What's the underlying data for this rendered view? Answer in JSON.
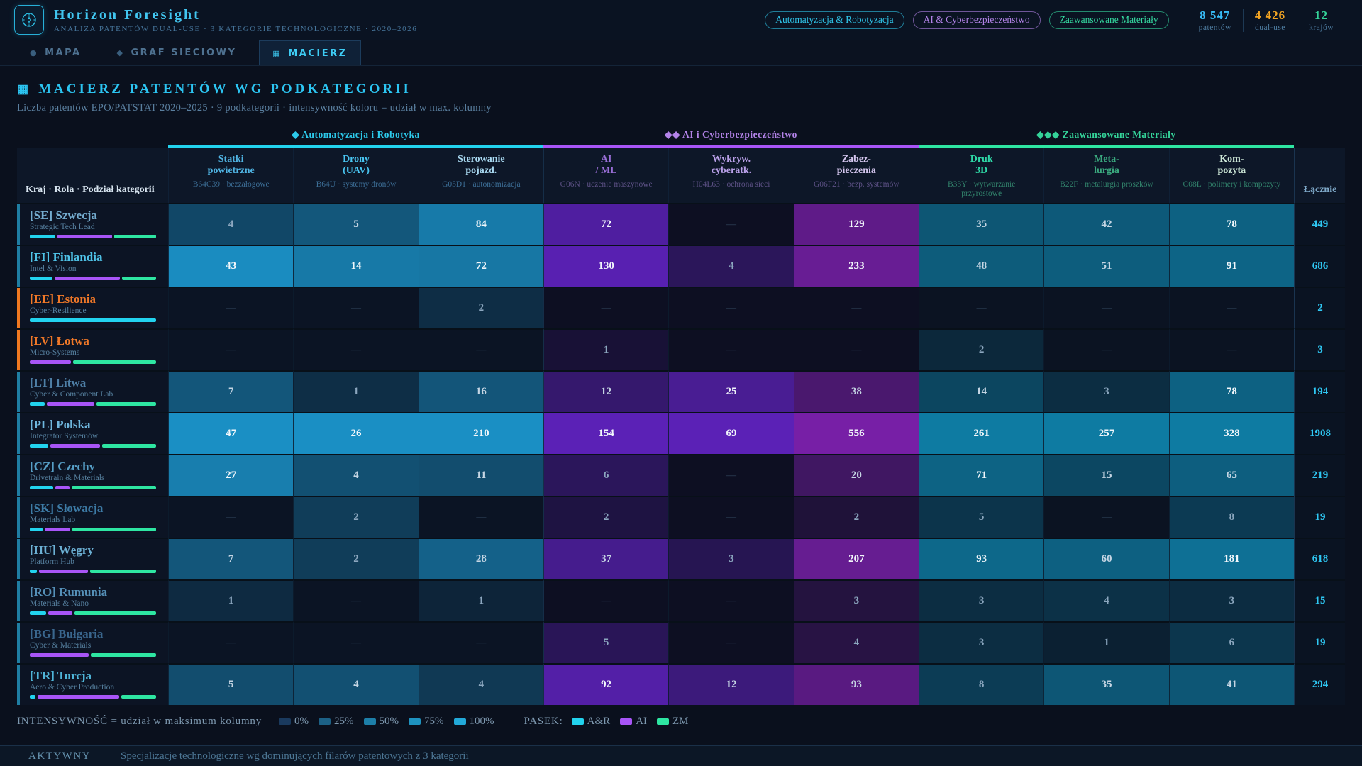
{
  "header": {
    "title": "Horizon Foresight",
    "subtitle": "ANALIZA PATENTÓW DUAL-USE · 3 KATEGORIE TECHNOLOGICZNE · 2020–2026",
    "badges": [
      {
        "label": "Automatyzacja & Robotyzacja",
        "color": "#2fc4e8"
      },
      {
        "label": "AI & Cyberbezpieczeństwo",
        "color": "#b383e8"
      },
      {
        "label": "Zaawansowane Materiały",
        "color": "#35d9a0"
      }
    ],
    "stats": [
      {
        "value": "8 547",
        "label": "patentów",
        "color": "#38bdf8"
      },
      {
        "value": "4 426",
        "label": "dual-use",
        "color": "#f5a623"
      },
      {
        "value": "12",
        "label": "krajów",
        "color": "#34d399"
      }
    ]
  },
  "tabs": [
    {
      "label": "MAPA",
      "icon": "circle",
      "active": false
    },
    {
      "label": "GRAF SIECIOWY",
      "icon": "diamond",
      "active": false
    },
    {
      "label": "MACIERZ",
      "icon": "grid",
      "active": true
    }
  ],
  "section": {
    "icon": "▦",
    "title": "MACIERZ PATENTÓW WG PODKATEGORII",
    "subtitle": "Liczba patentów EPO/PATSTAT 2020–2025 · 9 podkategorii · intensywność koloru = udział w max. kolumny"
  },
  "chart_data": {
    "type": "heatmap",
    "title": "MACIERZ PATENTÓW WG PODKATEGORII",
    "row_header": "Kraj · Rola · Podział kategorii",
    "total_header": "Łącznie",
    "groups": [
      {
        "label": "◆ Automatyzacja i Robotyka",
        "color": "#2cc9ea",
        "bar": "#22d3ee",
        "span": 3
      },
      {
        "label": "◆◆ AI i Cyberbezpieczeństwo",
        "color": "#b383e8",
        "bar": "#a855f7",
        "span": 3
      },
      {
        "label": "◆◆◆ Zaawansowane Materiały",
        "color": "#34d399",
        "bar": "#2ee6a2",
        "span": 3
      }
    ],
    "columns": [
      {
        "title": "Statki\npowietrzne",
        "sub": "B64C39 · bezzałogowe",
        "group": 0,
        "title_color": "#4fb3e2",
        "sub_color": "#3c6e96",
        "base": "#0b1424",
        "accent": "#1a8fc4"
      },
      {
        "title": "Drony\n(UAV)",
        "sub": "B64U · systemy dronów",
        "group": 0,
        "title_color": "#49c6f2",
        "sub_color": "#3c6e96",
        "base": "#0b1424",
        "accent": "#1a8fc4"
      },
      {
        "title": "Sterowanie\npojazd.",
        "sub": "G05D1 · autonomizacja",
        "group": 0,
        "title_color": "#a8d8f0",
        "sub_color": "#3c6e96",
        "base": "#0b1424",
        "accent": "#1a8fc4"
      },
      {
        "title": "AI\n/ ML",
        "sub": "G06N · uczenie maszynowe",
        "group": 1,
        "title_color": "#9a6fd8",
        "sub_color": "#5d5186",
        "base": "#0d0f22",
        "accent": "#5b21b6"
      },
      {
        "title": "Wykryw.\ncyberatk.",
        "sub": "H04L63 · ochrona sieci",
        "group": 1,
        "title_color": "#b9a0e8",
        "sub_color": "#5d5186",
        "base": "#0d0f22",
        "accent": "#5b21b6"
      },
      {
        "title": "Zabez-\npieczenia",
        "sub": "G06F21 · bezp. systemów",
        "group": 1,
        "title_color": "#d4c6ee",
        "sub_color": "#5d5186",
        "base": "#0d0f22",
        "accent": "#771fa6"
      },
      {
        "title": "Druk\n3D",
        "sub": "B33Y · wytwarzanie przyrostowe",
        "group": 2,
        "title_color": "#2ed8a6",
        "sub_color": "#31826b",
        "base": "#0b1322",
        "accent": "#0e7ba2"
      },
      {
        "title": "Meta-\nlurgia",
        "sub": "B22F · metalurgia proszków",
        "group": 2,
        "title_color": "#3aa87e",
        "sub_color": "#31826b",
        "base": "#0b1322",
        "accent": "#0e7ba2"
      },
      {
        "title": "Kom-\npozyta",
        "sub": "C08L · polimery i kompozyty",
        "group": 2,
        "title_color": "#cce6d6",
        "sub_color": "#31826b",
        "base": "#0b1322",
        "accent": "#0e7ba2"
      }
    ],
    "rows": [
      {
        "name": "[SE] Szwecja",
        "role": "Strategic Tech Lead",
        "values": [
          4,
          5,
          84,
          72,
          0,
          129,
          35,
          42,
          78
        ],
        "total": 449,
        "name_color": "#74accf",
        "highlight": false
      },
      {
        "name": "[FI] Finlandia",
        "role": "Intel & Vision",
        "values": [
          43,
          14,
          72,
          130,
          4,
          233,
          48,
          51,
          91
        ],
        "total": 686,
        "name_color": "#4fc3e8",
        "highlight": false
      },
      {
        "name": "[EE] Estonia",
        "role": "Cyber-Resilience",
        "values": [
          0,
          0,
          2,
          0,
          0,
          0,
          0,
          0,
          0
        ],
        "total": 2,
        "name_color": "#f07828",
        "highlight": true
      },
      {
        "name": "[LV] Łotwa",
        "role": "Micro-Systems",
        "values": [
          0,
          0,
          0,
          1,
          0,
          0,
          2,
          0,
          0
        ],
        "total": 3,
        "name_color": "#f07828",
        "highlight": true
      },
      {
        "name": "[LT] Litwa",
        "role": "Cyber & Component Lab",
        "values": [
          7,
          1,
          16,
          12,
          25,
          38,
          14,
          3,
          78
        ],
        "total": 194,
        "name_color": "#4e7fa6",
        "highlight": false
      },
      {
        "name": "[PL] Polska",
        "role": "Integrator Systemów",
        "values": [
          47,
          26,
          210,
          154,
          69,
          556,
          261,
          257,
          328
        ],
        "total": 1908,
        "name_color": "#6fb7de",
        "highlight": false
      },
      {
        "name": "[CZ] Czechy",
        "role": "Drivetrain & Materials",
        "values": [
          27,
          4,
          11,
          6,
          0,
          20,
          71,
          15,
          65
        ],
        "total": 219,
        "name_color": "#569ec6",
        "highlight": false
      },
      {
        "name": "[SK] Słowacja",
        "role": "Materials Lab",
        "values": [
          0,
          2,
          0,
          2,
          0,
          2,
          5,
          0,
          8
        ],
        "total": 19,
        "name_color": "#3d7ba6",
        "highlight": false
      },
      {
        "name": "[HU] Węgry",
        "role": "Platform Hub",
        "values": [
          7,
          2,
          28,
          37,
          3,
          207,
          93,
          60,
          181
        ],
        "total": 618,
        "name_color": "#6cb0d4",
        "highlight": false
      },
      {
        "name": "[RO] Rumunia",
        "role": "Materials & Nano",
        "values": [
          1,
          0,
          1,
          0,
          0,
          3,
          3,
          4,
          3
        ],
        "total": 15,
        "name_color": "#5590b8",
        "highlight": false
      },
      {
        "name": "[BG] Bułgaria",
        "role": "Cyber & Materials",
        "values": [
          0,
          0,
          0,
          5,
          0,
          4,
          3,
          1,
          6
        ],
        "total": 19,
        "name_color": "#3a678e",
        "highlight": false
      },
      {
        "name": "[TR] Turcja",
        "role": "Aero & Cyber Production",
        "values": [
          5,
          4,
          4,
          92,
          12,
          93,
          8,
          35,
          41
        ],
        "total": 294,
        "name_color": "#4fb5d8",
        "highlight": false
      }
    ],
    "bar_colors": [
      "#22d3ee",
      "#a855f7",
      "#2ee6a2"
    ],
    "strip_color_normal": "#1f7ea3",
    "strip_color_highlight": "#f07820"
  },
  "legend": {
    "intensity_label": "INTENSYWNOŚĆ = udział w maksimum kolumny",
    "intensity_steps": [
      {
        "label": "0%",
        "color": "#1a3a5e"
      },
      {
        "label": "25%",
        "color": "#1c6186"
      },
      {
        "label": "50%",
        "color": "#1d7fa8"
      },
      {
        "label": "75%",
        "color": "#1e93c0"
      },
      {
        "label": "100%",
        "color": "#22a9d8"
      }
    ],
    "pasek_label": "PASEK:",
    "pasek_items": [
      {
        "label": "A&R",
        "color": "#22d3ee"
      },
      {
        "label": "AI",
        "color": "#a855f7"
      },
      {
        "label": "ZM",
        "color": "#2ee6a2"
      }
    ]
  },
  "statusbar": {
    "state": "AKTYWNY",
    "text": "Specjalizacje technologiczne wg dominujących filarów patentowych z 3 kategorii"
  }
}
